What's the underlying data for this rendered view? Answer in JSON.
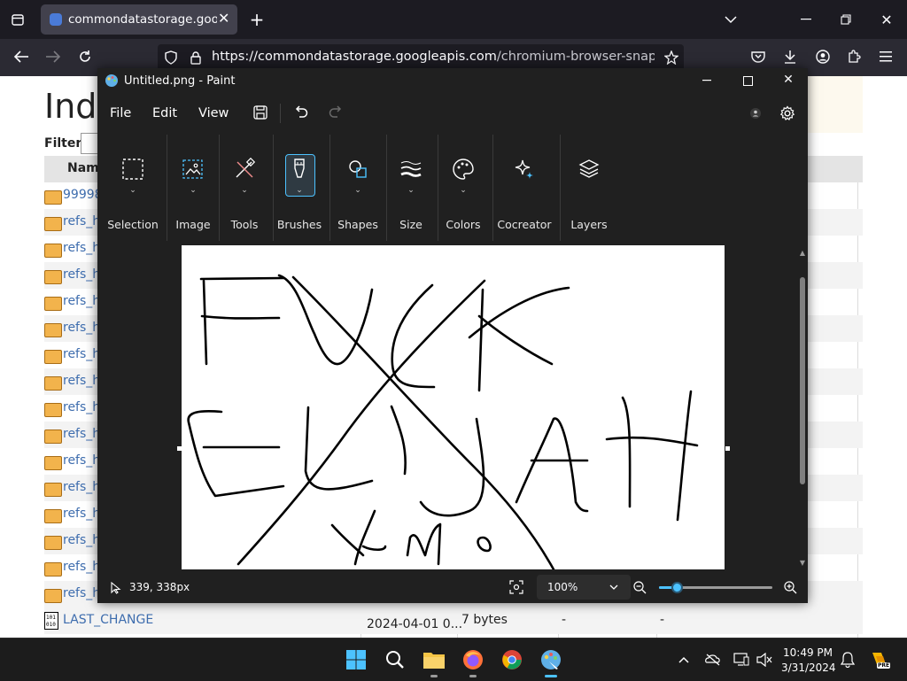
{
  "browser": {
    "tab_title": "commondatastorage.googleapis.com",
    "url_host": "https://commondatastorage.googleapis.com",
    "url_path": "/chromium-browser-snapshots/index"
  },
  "webpage": {
    "title": "Inde",
    "filter_label": "Filter:",
    "column_name": "Name",
    "rows": [
      {
        "label": "99998"
      },
      {
        "label": "refs_h"
      },
      {
        "label": "refs_h"
      },
      {
        "label": "refs_h"
      },
      {
        "label": "refs_h"
      },
      {
        "label": "refs_h"
      },
      {
        "label": "refs_h"
      },
      {
        "label": "refs_h"
      },
      {
        "label": "refs_h"
      },
      {
        "label": "refs_h"
      },
      {
        "label": "refs_h"
      },
      {
        "label": "refs_h"
      },
      {
        "label": "refs_h"
      },
      {
        "label": "refs_h"
      },
      {
        "label": "refs_h"
      },
      {
        "label": "refs_h"
      }
    ],
    "last_row": {
      "label": "LAST_CHANGE",
      "date": "2024-04-01 0...",
      "size": "7 bytes",
      "c1": "-",
      "c2": "-"
    }
  },
  "paint": {
    "window_title": "Untitled.png - Paint",
    "menu": [
      "File",
      "Edit",
      "View"
    ],
    "tools": [
      "Selection",
      "Image",
      "Tools",
      "Brushes",
      "Shapes",
      "Size",
      "Colors",
      "Cocreator",
      "Layers"
    ],
    "status_position": "339, 338px",
    "zoom_level": "100%",
    "zoom_slider_fraction": 0.17,
    "accent_color": "#4cc2ff"
  },
  "taskbar": {
    "time": "10:49 PM",
    "date": "3/31/2024",
    "badge": "PRE"
  }
}
